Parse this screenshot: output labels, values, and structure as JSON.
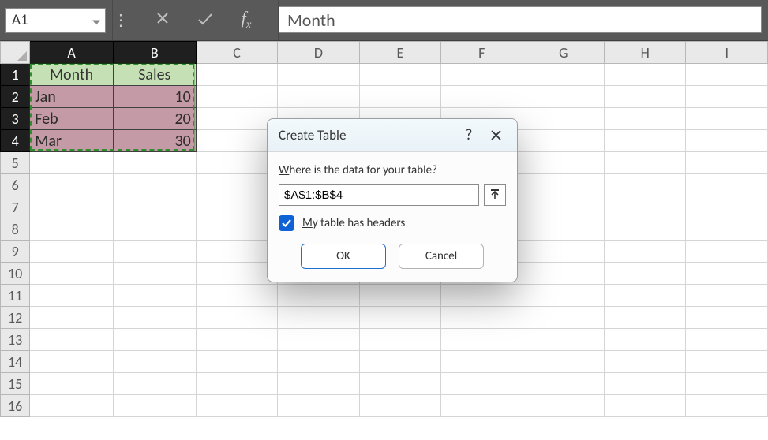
{
  "topbar": {
    "namebox_value": "A1",
    "formula_value": "Month"
  },
  "columns": [
    "A",
    "B",
    "C",
    "D",
    "E",
    "F",
    "G",
    "H",
    "I"
  ],
  "selected_cols": [
    "A",
    "B"
  ],
  "row_count": 16,
  "selected_rows": [
    1,
    2,
    3,
    4
  ],
  "cells": {
    "A1": "Month",
    "B1": "Sales",
    "A2": "Jan",
    "B2": "10",
    "A3": "Feb",
    "B3": "20",
    "A4": "Mar",
    "B4": "30"
  },
  "dialog": {
    "title": "Create Table",
    "where_label_pre": "W",
    "where_label_rest": "here is the data for your table?",
    "range_value": "$A$1:$B$4",
    "checkbox_label_pre": "M",
    "checkbox_label_rest": "y table has headers",
    "checkbox_checked": true,
    "ok_label": "OK",
    "cancel_label": "Cancel"
  }
}
